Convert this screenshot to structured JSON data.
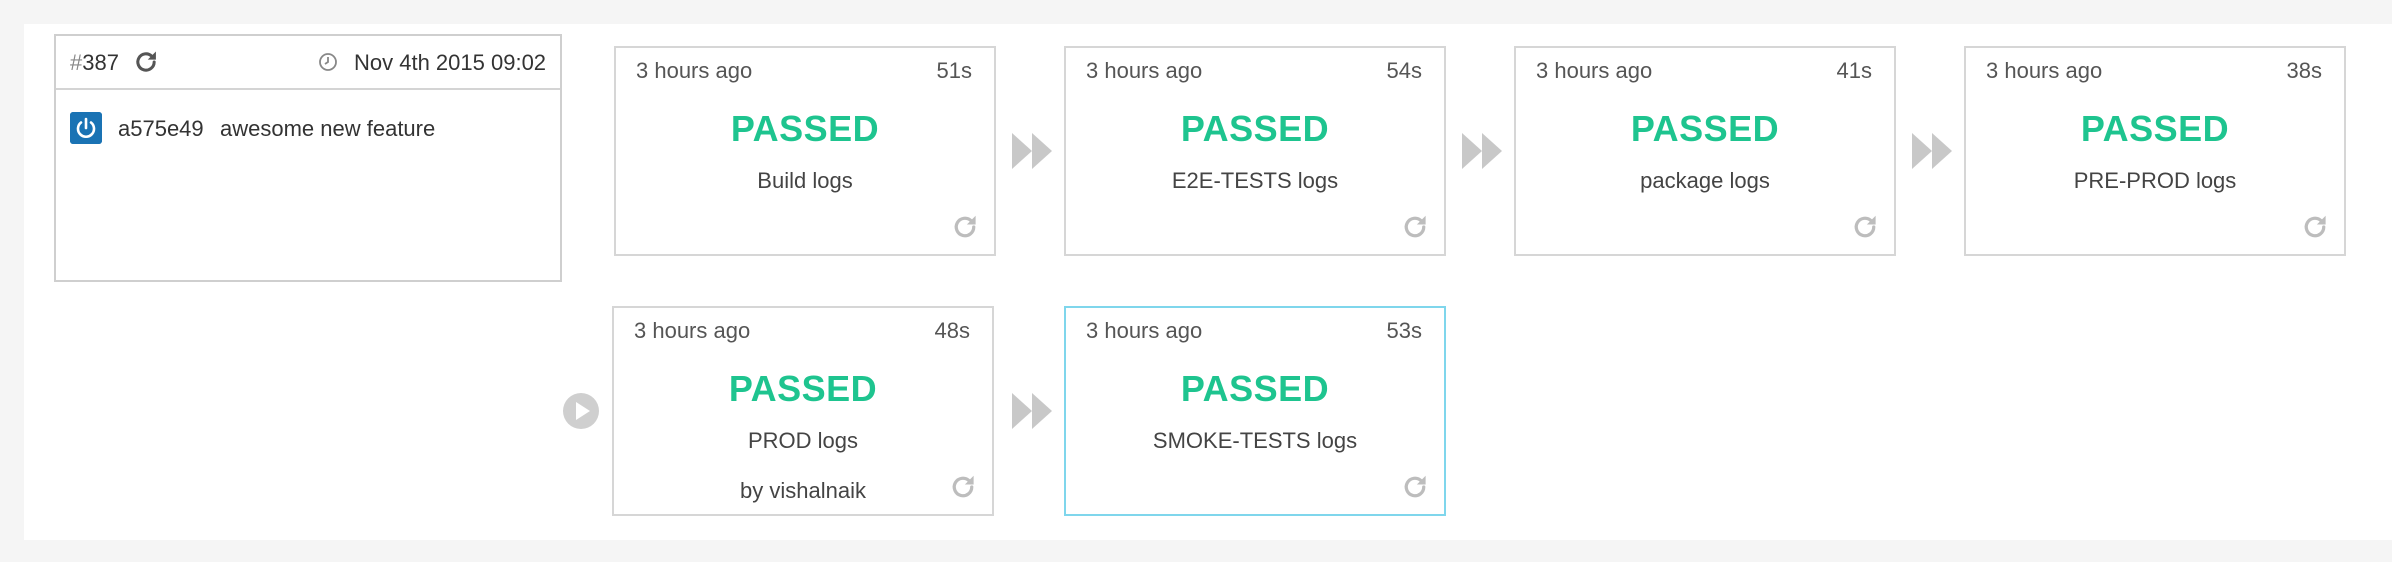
{
  "build": {
    "hash_symbol": "#",
    "number": "387",
    "date": "Nov 4th 2015 09:02",
    "commit_sha": "a575e49",
    "commit_message": "awesome new feature"
  },
  "stages": [
    {
      "ago": "3 hours ago",
      "duration": "51s",
      "status": "PASSED",
      "logs": "Build logs"
    },
    {
      "ago": "3 hours ago",
      "duration": "54s",
      "status": "PASSED",
      "logs": "E2E-TESTS logs"
    },
    {
      "ago": "3 hours ago",
      "duration": "41s",
      "status": "PASSED",
      "logs": "package logs"
    },
    {
      "ago": "3 hours ago",
      "duration": "38s",
      "status": "PASSED",
      "logs": "PRE-PROD logs"
    },
    {
      "ago": "3 hours ago",
      "duration": "48s",
      "status": "PASSED",
      "logs": "PROD logs",
      "triggered_by": "by vishalnaik"
    },
    {
      "ago": "3 hours ago",
      "duration": "53s",
      "status": "PASSED",
      "logs": "SMOKE-TESTS logs"
    }
  ],
  "colors": {
    "passed": "#1ec48f",
    "active_border": "#7fd6ec",
    "avatar": "#1a73b4"
  },
  "icons": {
    "rerun": "refresh-icon",
    "clock": "clock-icon",
    "arrow": "double-chevron-right-icon",
    "play": "play-icon"
  }
}
